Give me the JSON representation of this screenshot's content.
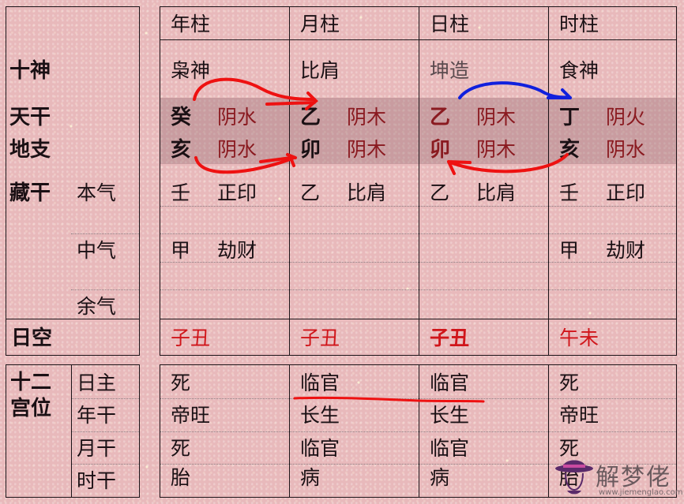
{
  "left_panel": {
    "shishen": "十神",
    "tiangan": "天干",
    "dizhi": "地支",
    "canggan": "藏干",
    "benqi": "本气",
    "zhongqi": "中气",
    "yuqi": "余气",
    "rikong": "日空",
    "shier_line1": "十二",
    "shier_line2": "宫位",
    "rizhu": "日主",
    "niangan": "年干",
    "yuegan": "月干",
    "shigan": "时干"
  },
  "pillars": [
    {
      "header": "年柱",
      "shishen": "枭神",
      "tiangan": {
        "char": "癸",
        "element": "阴水"
      },
      "dizhi": {
        "char": "亥",
        "element": "阴水"
      },
      "benqi": {
        "stem": "壬",
        "god": "正印"
      },
      "zhongqi": {
        "stem": "甲",
        "god": "劫财"
      },
      "yuqi": {
        "stem": "",
        "god": ""
      },
      "rikong": "子丑",
      "palace": [
        "死",
        "帝旺",
        "死",
        "胎"
      ]
    },
    {
      "header": "月柱",
      "shishen": "比肩",
      "tiangan": {
        "char": "乙",
        "element": "阴木"
      },
      "dizhi": {
        "char": "卯",
        "element": "阴木"
      },
      "benqi": {
        "stem": "乙",
        "god": "比肩"
      },
      "zhongqi": {
        "stem": "",
        "god": ""
      },
      "yuqi": {
        "stem": "",
        "god": ""
      },
      "rikong": "子丑",
      "palace": [
        "临官",
        "长生",
        "临官",
        "病"
      ]
    },
    {
      "header": "日柱",
      "shishen": "坤造",
      "tiangan": {
        "char": "乙",
        "element": "阴木"
      },
      "dizhi": {
        "char": "卯",
        "element": "阴木"
      },
      "benqi": {
        "stem": "乙",
        "god": "比肩"
      },
      "zhongqi": {
        "stem": "",
        "god": ""
      },
      "yuqi": {
        "stem": "",
        "god": ""
      },
      "rikong": "子丑",
      "palace": [
        "临官",
        "长生",
        "临官",
        "病"
      ]
    },
    {
      "header": "时柱",
      "shishen": "食神",
      "tiangan": {
        "char": "丁",
        "element": "阴火"
      },
      "dizhi": {
        "char": "亥",
        "element": "阴水"
      },
      "benqi": {
        "stem": "壬",
        "god": "正印"
      },
      "zhongqi": {
        "stem": "甲",
        "god": "劫财"
      },
      "yuqi": {
        "stem": "",
        "god": ""
      },
      "rikong": "午未",
      "palace": [
        "死",
        "帝旺",
        "死",
        "胎"
      ]
    }
  ],
  "watermark": {
    "name": "解梦佬",
    "url": "www.jiemenglao.com"
  },
  "colors": {
    "background": "#e8b9bb",
    "band": "#c9a0a3",
    "red_text": "#d0151a",
    "dark_red_text": "#8a1a20",
    "annotation_red": "#ee1111",
    "annotation_blue": "#1020dd"
  }
}
